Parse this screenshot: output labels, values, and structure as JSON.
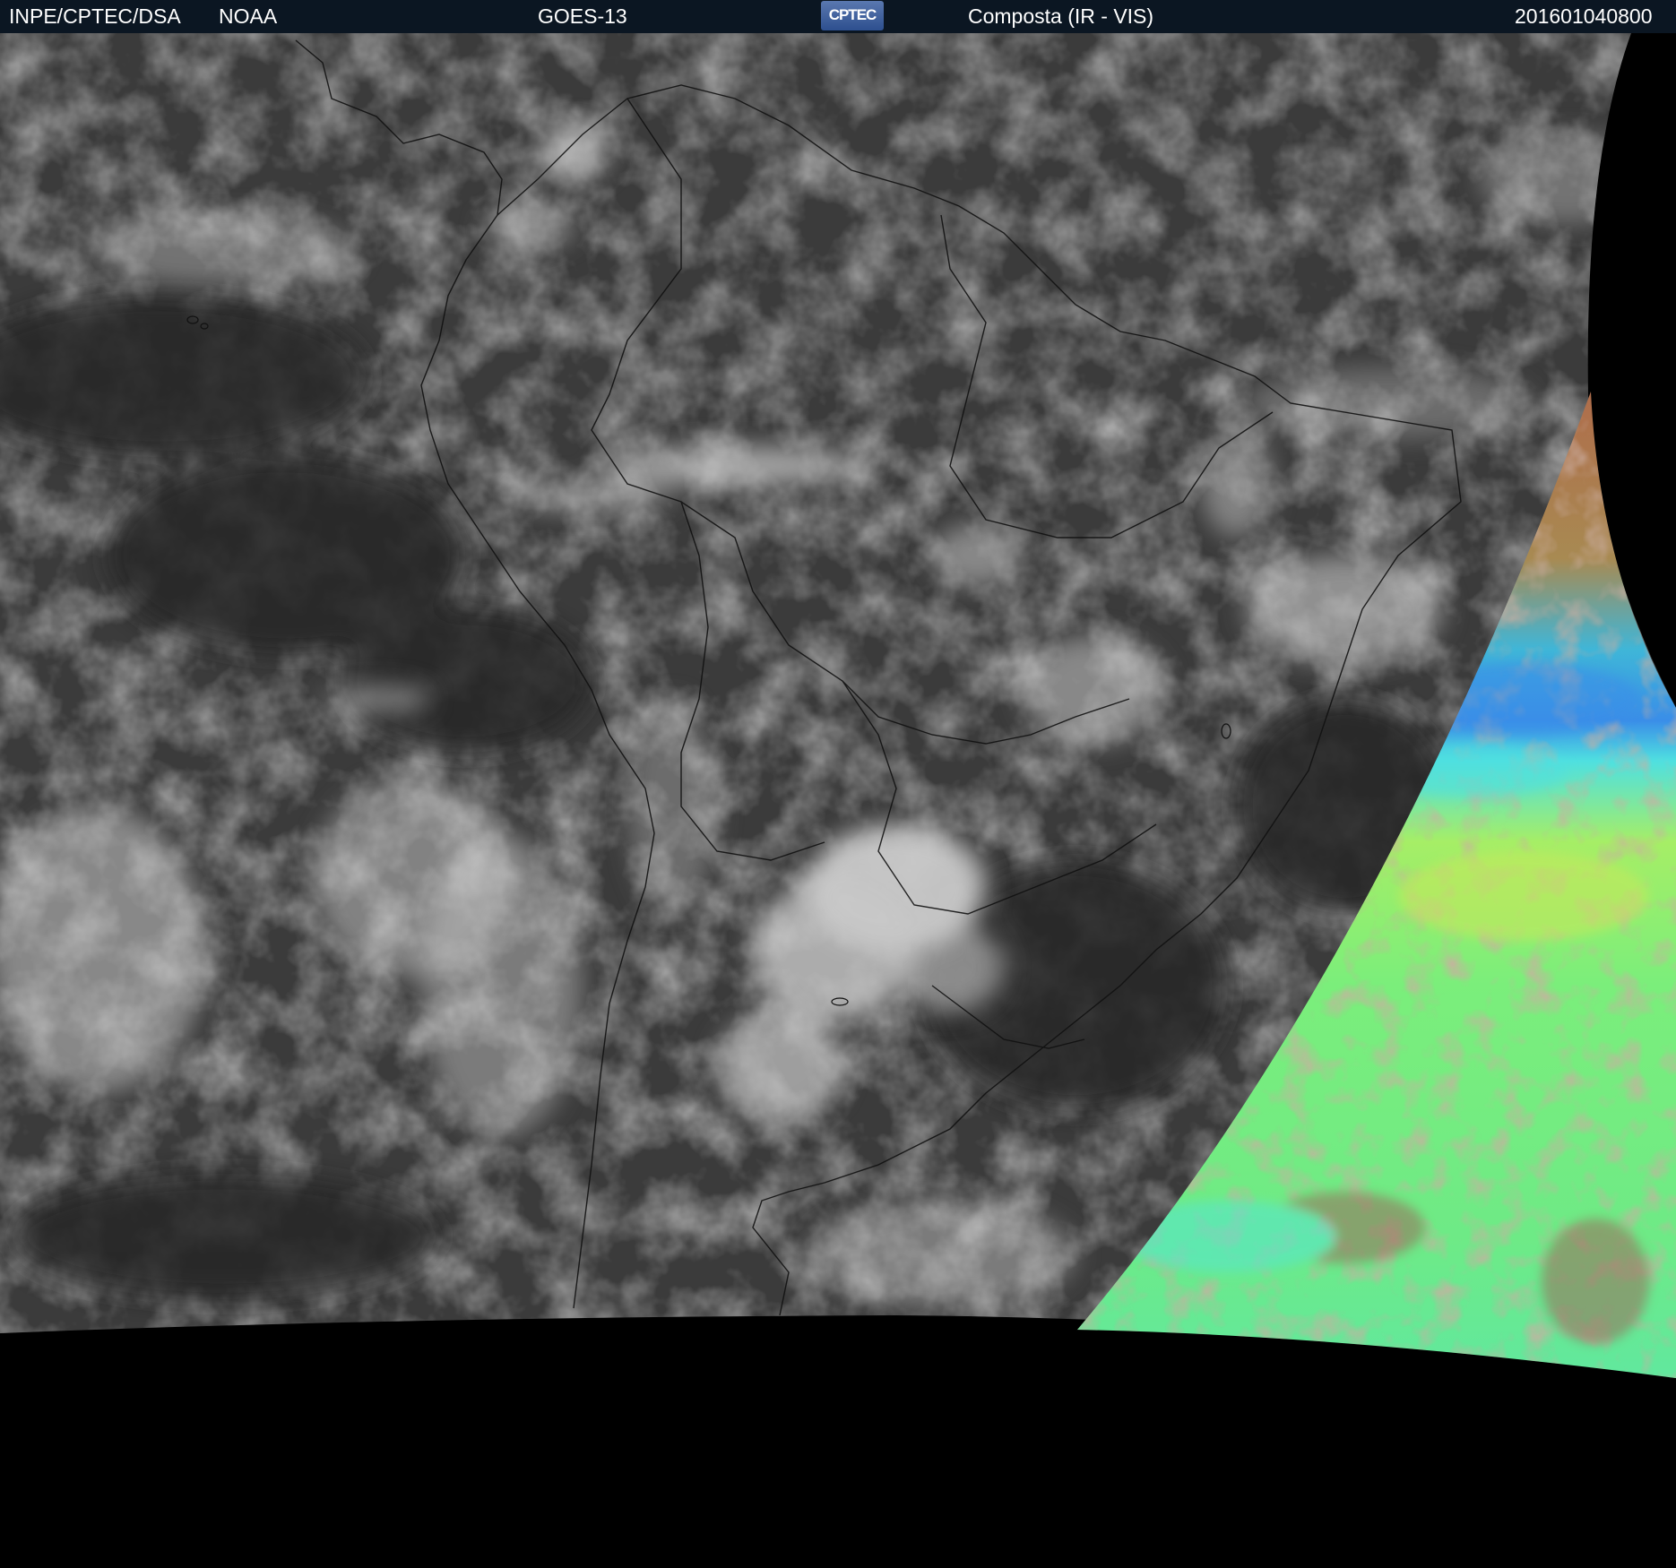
{
  "header": {
    "org": "INPE/CPTEC/DSA",
    "agency": "NOAA",
    "satellite": "GOES-13",
    "logo_text": "CPTEC",
    "product": "Composta (IR - VIS)",
    "timestamp": "201601040800"
  },
  "colors": {
    "header_bg": "#0b1622",
    "space": "#000000",
    "ocean_dark": "#3a3a3a",
    "cloud_light": "#c8c8c8",
    "vis_green": "#77ee77",
    "vis_cyan": "#3fd6e8",
    "vis_blue": "#3a8ee8",
    "vis_brown": "#9a6a5a"
  },
  "image": {
    "type": "satellite-composite",
    "region": "south-america"
  }
}
